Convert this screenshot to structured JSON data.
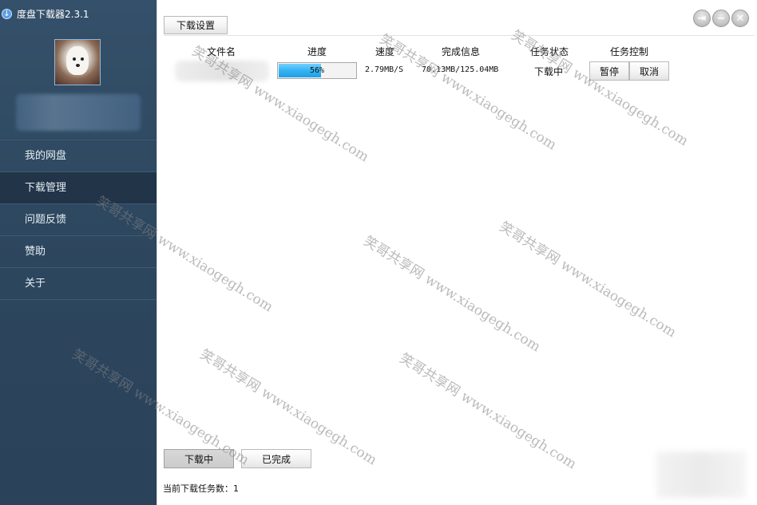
{
  "app": {
    "title": "度盘下载器2.3.1",
    "logo_icon": "download-circle-icon"
  },
  "sidebar": {
    "menu": [
      {
        "label": "我的网盘",
        "active": false
      },
      {
        "label": "下载管理",
        "active": true
      },
      {
        "label": "问题反馈",
        "active": false
      },
      {
        "label": "赞助",
        "active": false
      },
      {
        "label": "关于",
        "active": false
      }
    ]
  },
  "toolbar": {
    "settings_label": "下载设置"
  },
  "window_controls": [
    "exit-icon",
    "minimize-icon",
    "close-icon"
  ],
  "table": {
    "headers": {
      "filename": "文件名",
      "progress": "进度",
      "speed": "速度",
      "done_info": "完成信息",
      "status": "任务状态",
      "control": "任务控制"
    },
    "rows": [
      {
        "progress_text": "56%",
        "progress_value": 0.56,
        "speed": "2.79MB/S",
        "done_info": "70.13MB/125.04MB",
        "status": "下载中",
        "pause_label": "暂停",
        "cancel_label": "取消"
      }
    ]
  },
  "tabs": {
    "downloading": "下载中",
    "done": "已完成"
  },
  "footer": {
    "task_count_label": "当前下载任务数：1"
  },
  "watermark": "笑哥共享网 www.xiaogegh.com",
  "colors": {
    "sidebar_bg": "#2d475f",
    "sidebar_active": "#213448",
    "progress_fill": "#35b3f2"
  }
}
